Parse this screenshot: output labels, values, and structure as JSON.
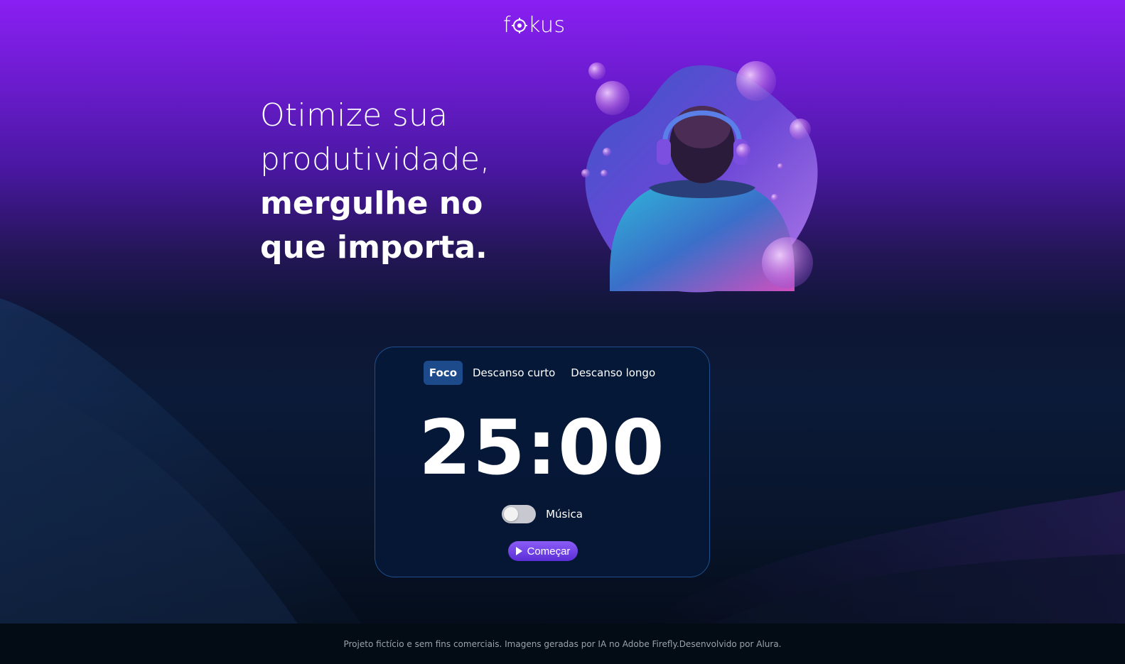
{
  "app": {
    "logo_text_left": "f",
    "logo_text_right": "kus",
    "logo_icon": "target-icon"
  },
  "headline": {
    "line1": "Otimize sua",
    "line2": "produtividade,",
    "line3": "mergulhe no",
    "line4": "que importa."
  },
  "hero": {
    "image": "person-with-headphones-illustration"
  },
  "timer_card": {
    "tabs": [
      {
        "label": "Foco",
        "active": true
      },
      {
        "label": "Descanso curto",
        "active": false
      },
      {
        "label": "Descanso longo",
        "active": false
      }
    ],
    "time": "25:00",
    "music_label": "Música",
    "music_on": false,
    "start_label": "Começar",
    "start_icon": "play-icon"
  },
  "footer": {
    "text": "Projeto fictício e sem fins comerciais. Imagens geradas por IA no Adobe Firefly.Desenvolvido por Alura."
  },
  "colors": {
    "accent": "#8b5cf6",
    "tab_active": "#1c4a8a",
    "card_border": "#1f4f8f"
  }
}
